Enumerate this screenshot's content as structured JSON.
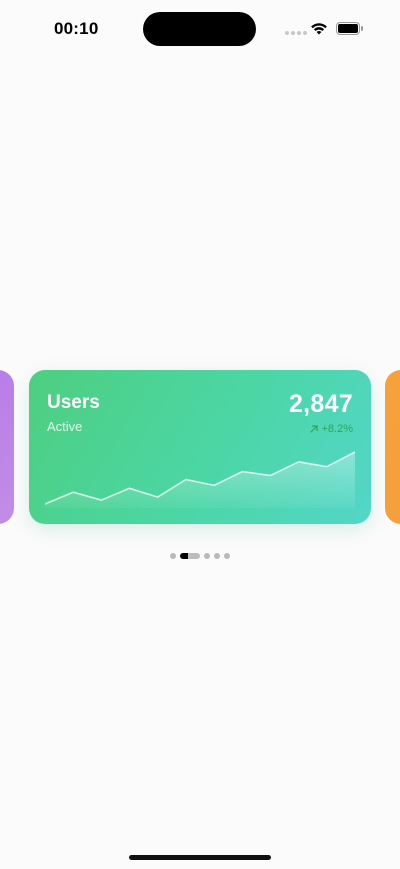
{
  "status_bar": {
    "time": "00:10",
    "icons": [
      "cellular-icon",
      "wifi-icon",
      "battery-icon"
    ]
  },
  "carousel": {
    "cards": [
      {
        "id": "prev",
        "color": "#b57ae8"
      },
      {
        "id": "users",
        "title": "Users",
        "subtitle": "Active",
        "value": "2,847",
        "change": "+8.2%",
        "change_icon": "arrow-up-right-icon",
        "change_color": "#2fa55a",
        "gradient": [
          "#4dcf80",
          "#53d6c8"
        ],
        "sparkline": [
          2,
          14,
          6,
          18,
          9,
          27,
          21,
          35,
          31,
          45,
          40,
          55
        ]
      },
      {
        "id": "next",
        "color": "#f7a13a"
      }
    ],
    "page_count": 6,
    "active_page": 1
  }
}
